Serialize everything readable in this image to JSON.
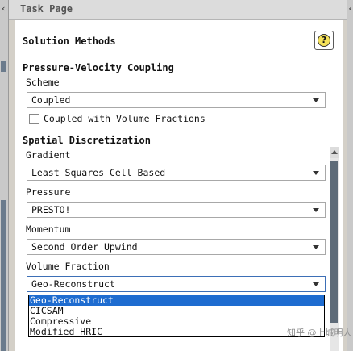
{
  "window": {
    "title": "Task Page",
    "collapse_left_glyph": "‹",
    "collapse_right_glyph": "‹"
  },
  "page": {
    "heading": "Solution Methods",
    "help_glyph": "?"
  },
  "pressure_velocity": {
    "section_title": "Pressure-Velocity Coupling",
    "scheme_label": "Scheme",
    "scheme_value": "Coupled",
    "volume_fractions_checkbox_label": "Coupled with Volume Fractions",
    "volume_fractions_checked": false
  },
  "spatial": {
    "section_title": "Spatial Discretization",
    "gradient_label": "Gradient",
    "gradient_value": "Least Squares Cell Based",
    "pressure_label": "Pressure",
    "pressure_value": "PRESTO!",
    "momentum_label": "Momentum",
    "momentum_value": "Second Order Upwind",
    "volume_fraction_label": "Volume Fraction",
    "volume_fraction_value": "Geo-Reconstruct",
    "volume_fraction_options": [
      "Geo-Reconstruct",
      "CICSAM",
      "Compressive",
      "Modified HRIC"
    ]
  },
  "watermark": "知乎 @上城明人",
  "colors": {
    "selection": "#1e6cd0",
    "help_icon": "#f5e25a",
    "background": "#d4d0c8"
  }
}
